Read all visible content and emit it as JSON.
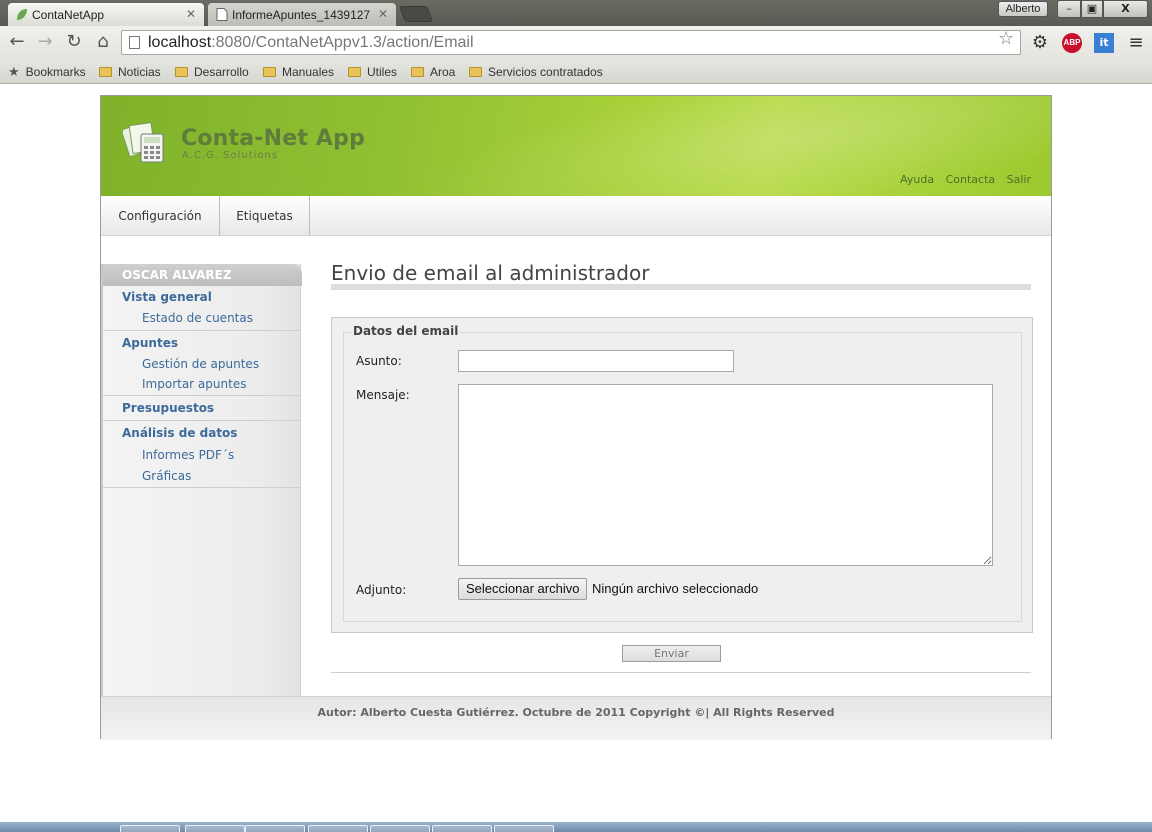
{
  "browser": {
    "tabs": [
      {
        "title": "ContaNetApp",
        "active": true
      },
      {
        "title": "InformeApuntes_1439127",
        "active": false
      }
    ],
    "profile_name": "Alberto",
    "window_controls": {
      "minimize": "–",
      "maximize": "▣",
      "close": "X"
    },
    "address": {
      "host": "localhost",
      "path": ":8080/ContaNetAppv1.3/action/Email"
    },
    "extensions": {
      "abp": "ABP",
      "it": "it"
    },
    "bookmarks": [
      "Bookmarks",
      "Noticias",
      "Desarrollo",
      "Manuales",
      "Utiles",
      "Aroa",
      "Servicios contratados"
    ]
  },
  "app": {
    "title": "Conta-Net App",
    "subtitle": "A.C.G. Solutions",
    "top_links": [
      "Ayuda",
      "Contacta",
      "Salir"
    ],
    "nav": [
      "Configuración",
      "Etiquetas"
    ],
    "accent_color": "#9cc92e",
    "link_color": "#3d6a9a"
  },
  "sidebar": {
    "user": "OSCAR ALVAREZ",
    "groups": [
      {
        "label": "Vista general",
        "items": [
          "Estado de cuentas"
        ]
      },
      {
        "label": "Apuntes",
        "items": [
          "Gestión de apuntes",
          "Importar apuntes"
        ]
      },
      {
        "label": "Presupuestos",
        "items": []
      },
      {
        "label": "Análisis de datos",
        "items": [
          "Informes PDF´s",
          "Gráficas"
        ]
      }
    ]
  },
  "form": {
    "page_title": "Envio de email al administrador",
    "legend": "Datos del email",
    "asunto_label": "Asunto:",
    "asunto_value": "",
    "mensaje_label": "Mensaje:",
    "mensaje_value": "",
    "adjunto_label": "Adjunto:",
    "file_button": "Seleccionar archivo",
    "file_status": "Ningún archivo seleccionado",
    "submit": "Enviar"
  },
  "footer": {
    "text": "Autor: Alberto Cuesta Gutiérrez. Octubre de 2011 Copyright ©| All Rights Reserved"
  }
}
